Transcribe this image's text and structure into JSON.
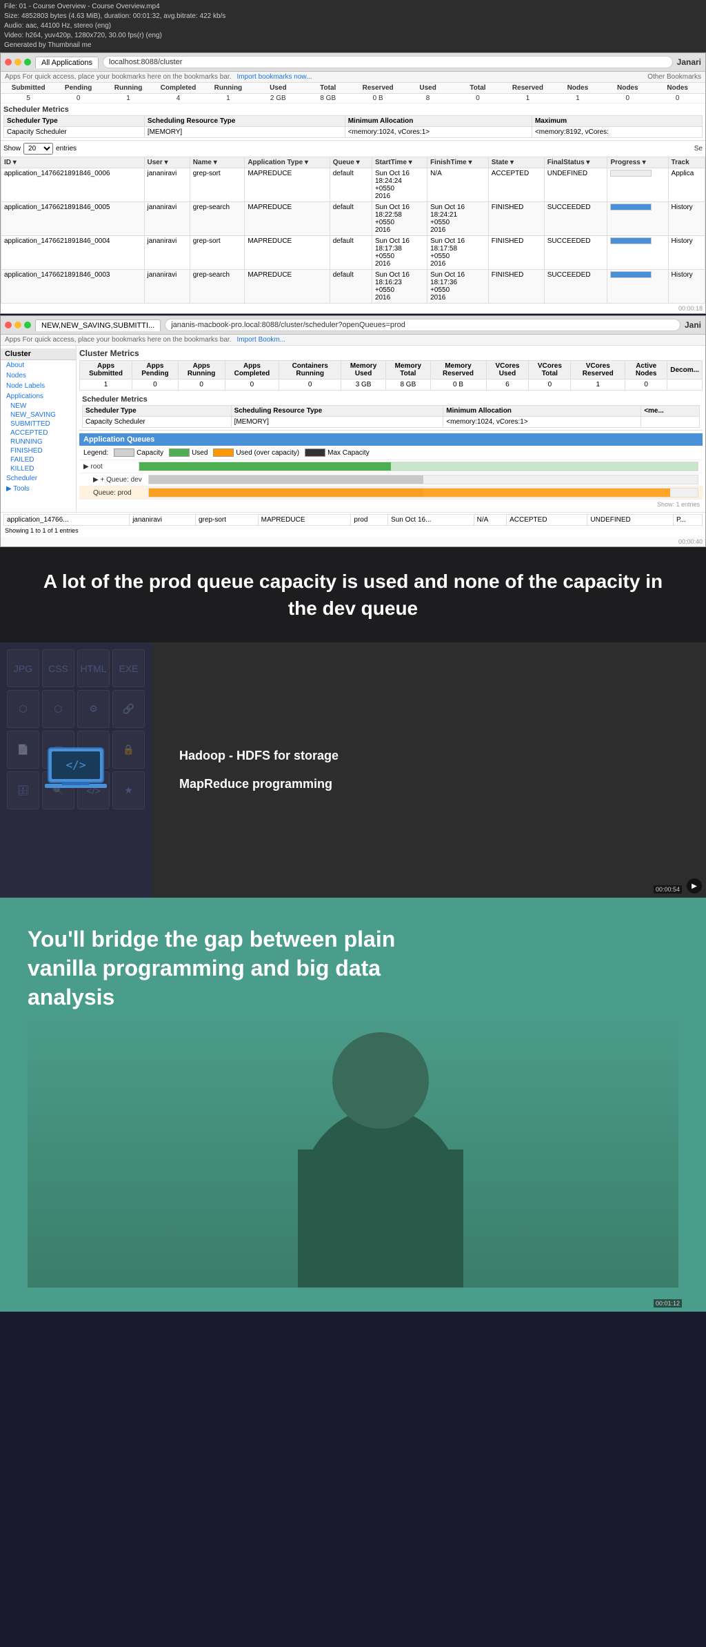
{
  "video_info": {
    "file": "File: 01 - Course Overview - Course Overview.mp4",
    "size": "Size: 4852803 bytes (4.63 MiB), duration: 00:01:32, avg.bitrate: 422 kb/s",
    "audio": "Audio: aac, 44100 Hz, stereo (eng)",
    "video": "Video: h264, yuv420p, 1280x720, 30.00 fps(r) (eng)",
    "generated": "Generated by Thumbnail me"
  },
  "browser1": {
    "title": "All Applications",
    "url": "localhost:8088/cluster",
    "brand": "Janari",
    "bookmarks_text": "Apps  For quick access, place your bookmarks here on the bookmarks bar.",
    "bookmarks_link": "Import bookmarks now...",
    "bookmarks_right": "Other Bookmarks"
  },
  "cluster_metrics_labels": [
    "Submitted",
    "Pending",
    "Running",
    "Completed",
    "Running",
    "Used",
    "Total",
    "Reserved",
    "Used",
    "Total",
    "Reserved",
    "Nodes",
    "Nodes",
    "Nodes"
  ],
  "cluster_metrics_values": [
    "5",
    "0",
    "1",
    "4",
    "1",
    "2 GB",
    "8 GB",
    "0 B",
    "8",
    "0",
    "1",
    "1",
    "0",
    "0"
  ],
  "scheduler_metrics": {
    "title": "Scheduler Metrics",
    "type_label": "Scheduler Type",
    "resource_label": "Scheduling Resource Type",
    "min_alloc_label": "Minimum Allocation",
    "max_label": "Maximum",
    "type_value": "Capacity Scheduler",
    "resource_value": "[MEMORY]",
    "min_alloc_value": "<memory:1024, vCores:1>",
    "max_value": "<memory:8192, vCores:"
  },
  "show_entries": {
    "label": "Show",
    "value": "20",
    "unit": "entries",
    "search_label": "Se"
  },
  "app_table": {
    "columns": [
      "ID",
      "User",
      "Name",
      "Application Type",
      "Queue",
      "StartTime",
      "FinishTime",
      "State",
      "FinalStatus",
      "Progress",
      "Track"
    ],
    "rows": [
      {
        "id": "application_1476621891846_0006",
        "user": "jananiravi",
        "name": "grep-sort",
        "type": "MAPREDUCE",
        "queue": "default",
        "start": "Sun Oct 16 18:24:24 +0550 2016",
        "finish": "N/A",
        "state": "ACCEPTED",
        "final_status": "UNDEFINED",
        "progress": "",
        "track": "Applica",
        "highlight": true
      },
      {
        "id": "application_1476621891846_0005",
        "user": "jananiravi",
        "name": "grep-search",
        "type": "MAPREDUCE",
        "queue": "default",
        "start": "Sun Oct 16 18:22:58 +0550 2016",
        "finish": "Sun Oct 16 18:24:21 +0550 2016",
        "state": "FINISHED",
        "final_status": "SUCCEEDED",
        "progress": "",
        "track": "History",
        "highlight": false
      },
      {
        "id": "application_1476621891846_0004",
        "user": "jananiravi",
        "name": "grep-sort",
        "type": "MAPREDUCE",
        "queue": "default",
        "start": "Sun Oct 16 18:17:38 +0550 2016",
        "finish": "Sun Oct 16 18:17:58 +0550 2016",
        "state": "FINISHED",
        "final_status": "SUCCEEDED",
        "progress": "",
        "track": "History",
        "highlight": false
      },
      {
        "id": "application_1476621891846_0003",
        "user": "jananiravi",
        "name": "grep-search",
        "type": "MAPREDUCE",
        "queue": "default",
        "start": "Sun Oct 16 18:16:23 +0550 2016",
        "finish": "Sun Oct 16 18:17:36 +0550 2016",
        "state": "FINISHED",
        "final_status": "SUCCEEDED",
        "progress": "",
        "track": "History",
        "highlight": false
      }
    ]
  },
  "browser2": {
    "title": "NEW,NEW_SAVING,SUBMITTI...",
    "url": "jananis-macbook-pro.local:8088/cluster/scheduler?openQueues=prod",
    "brand": "Jani",
    "bookmarks_text": "Apps  For quick access, place your bookmarks here on the bookmarks bar.",
    "bookmarks_link": "Import Bookm..."
  },
  "cluster2": {
    "sidebar": {
      "cluster_label": "Cluster",
      "items": [
        "About",
        "Nodes",
        "Node Labels",
        "Applications"
      ],
      "app_subitems": [
        "NEW",
        "NEW_SAVING",
        "SUBMITTED",
        "ACCEPTED",
        "RUNNING",
        "FINISHED",
        "FAILED",
        "KILLED"
      ],
      "scheduler_label": "Scheduler",
      "tools_label": "Tools"
    },
    "metrics": {
      "title": "Cluster Metrics",
      "labels": [
        "Apps Submitted",
        "Apps Pending",
        "Apps Running",
        "Apps Completed",
        "Containers Running",
        "Memory Used",
        "Memory Total",
        "Memory Reserved",
        "VCores Used",
        "VCores Total",
        "VCores Reserved",
        "Active Nodes",
        "Decom..."
      ],
      "values": [
        "1",
        "0",
        "0",
        "0",
        "0",
        "3 GB",
        "8 GB",
        "0 B",
        "6",
        "0",
        "1",
        "0"
      ]
    },
    "scheduler_metrics": {
      "title": "Scheduler Metrics",
      "type_label": "Scheduler Type",
      "resource_label": "Scheduling Resource Type",
      "min_alloc_label": "Minimum Allocation",
      "type_value": "Capacity Scheduler",
      "resource_value": "[MEMORY]",
      "min_alloc_value": "<memory:1024, vCores:1>",
      "max_label": "<me"
    }
  },
  "app_queues": {
    "title": "Application Queues",
    "legend": {
      "label": "Legend:",
      "capacity": "Capacity",
      "used": "Used",
      "used_over": "Used (over capacity)",
      "max_capacity": "Max Capacity"
    },
    "queues": [
      {
        "name": "root",
        "type": "root",
        "capacity_pct": 100,
        "used_pct": 50,
        "over_capacity": false,
        "indent": 0
      },
      {
        "name": "+ Queue: dev",
        "type": "dev",
        "capacity_pct": 50,
        "used_pct": 0,
        "over_capacity": false,
        "indent": 1
      },
      {
        "name": "Queue: prod",
        "type": "prod",
        "capacity_pct": 50,
        "used_pct": 95,
        "over_capacity": true,
        "indent": 1
      }
    ]
  },
  "overlay": {
    "text": "A lot of the prod queue capacity is used and none of the capacity in the dev queue"
  },
  "video_section2": {
    "items": [
      "Hadoop - HDFS for storage",
      "MapReduce programming"
    ],
    "timecode1": "00:00:54"
  },
  "final_section": {
    "title": "You'll bridge the gap between plain vanilla programming and big data analysis"
  },
  "timecodes": {
    "t1": "00:00:18",
    "t2": "00:00:40",
    "t3": "00:00:54",
    "t4": "00:01:12"
  }
}
